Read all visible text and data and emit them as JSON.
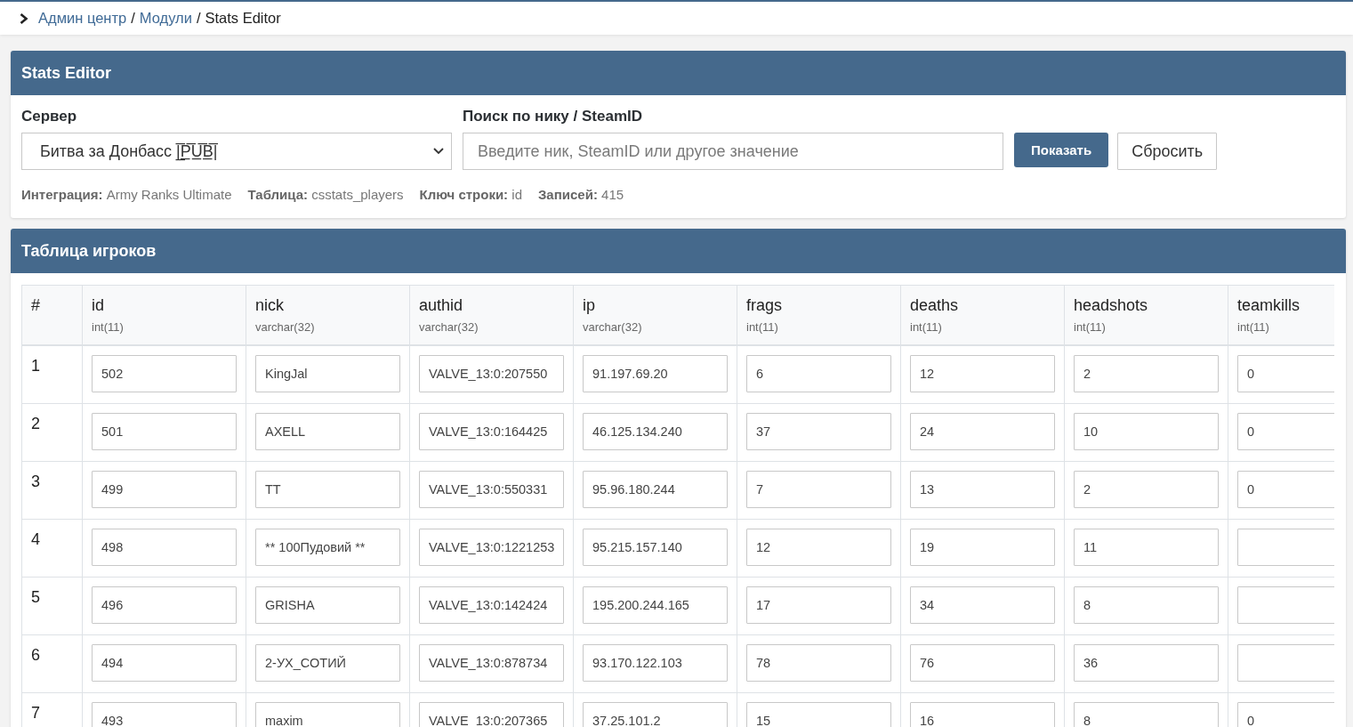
{
  "breadcrumb": {
    "separator": "/",
    "items": [
      {
        "label": "Админ центр",
        "kind": "link"
      },
      {
        "label": "Модули",
        "kind": "link"
      },
      {
        "label": "Stats Editor",
        "kind": "current"
      }
    ]
  },
  "editor": {
    "title": "Stats Editor",
    "server": {
      "label": "Сервер",
      "value": "Битва за Донбасс |̲̅P̲̅U̲̅B̲̅|"
    },
    "search": {
      "label": "Поиск по нику / SteamID",
      "placeholder": "Введите ник, SteamID или другое значение"
    },
    "buttons": [
      {
        "label": "Показать",
        "kind": "primary"
      },
      {
        "label": "Сбросить",
        "kind": "secondary"
      }
    ],
    "meta": [
      "**Интеграция:** Army Ranks Ultimate",
      "**Таблица:** csstats_players",
      "**Ключ строки:** id",
      "**Записей:** 415"
    ]
  },
  "players": {
    "title": "Таблица игроков",
    "columns": [
      {
        "name": "#"
      },
      {
        "name": "id",
        "type": "int(11)"
      },
      {
        "name": "nick",
        "type": "varchar(32)"
      },
      {
        "name": "authid",
        "type": "varchar(32)"
      },
      {
        "name": "ip",
        "type": "varchar(32)"
      },
      {
        "name": "frags",
        "type": "int(11)"
      },
      {
        "name": "deaths",
        "type": "int(11)"
      },
      {
        "name": "headshots",
        "type": "int(11)"
      },
      {
        "name": "teamkills",
        "type": "int(11)"
      }
    ],
    "rows": [
      {
        "cells": [
          "1",
          "502",
          "KingJal",
          "VALVE_13:0:207550",
          "91.197.69.20",
          "6",
          "12",
          "2",
          "0"
        ]
      },
      {
        "cells": [
          "2",
          "501",
          "AXELL",
          "VALVE_13:0:164425",
          "46.125.134.240",
          "37",
          "24",
          "10",
          "0"
        ]
      },
      {
        "cells": [
          "3",
          "499",
          "TT",
          "VALVE_13:0:550331",
          "95.96.180.244",
          "7",
          "13",
          "2",
          "0"
        ]
      },
      {
        "cells": [
          "4",
          "498",
          "** 100Пудовий **",
          "VALVE_13:0:1221253",
          "95.215.157.140",
          "12",
          "19",
          "11"
        ]
      },
      {
        "cells": [
          "5",
          "496",
          "GRISHA",
          "VALVE_13:0:142424",
          "195.200.244.165",
          "17",
          "34",
          "8"
        ]
      },
      {
        "cells": [
          "6",
          "494",
          "2-УХ_СОТИЙ",
          "VALVE_13:0:878734",
          "93.170.122.103",
          "78",
          "76",
          "36"
        ]
      },
      {
        "cells": [
          "7",
          "493",
          "maxim",
          "VALVE_13:0:207365",
          "37.25.101.2",
          "15",
          "16",
          "8",
          "0"
        ]
      }
    ]
  }
}
